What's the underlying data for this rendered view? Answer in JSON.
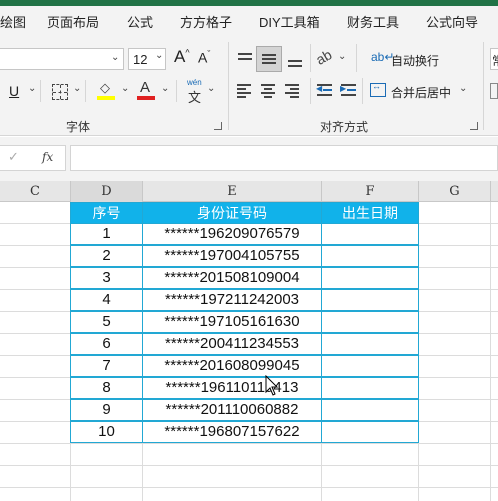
{
  "menu": {
    "tabs": [
      "绘图",
      "页面布局",
      "公式",
      "方方格子",
      "DIY工具箱",
      "财务工具",
      "公式向导"
    ]
  },
  "ribbon": {
    "font_size": "12",
    "font_group_label": "字体",
    "align_group_label": "对齐方式",
    "wrap_text_label": "自动换行",
    "merge_center_label": "合并后居中",
    "phonetic_top": "wén",
    "phonetic_bottom": "文",
    "font_grow": "A",
    "font_shrink": "A",
    "underline": "U",
    "right_edge_label": "常"
  },
  "formula_bar": {
    "fx_label": "fx",
    "content": ""
  },
  "columns": [
    "C",
    "D",
    "E",
    "F",
    "G"
  ],
  "table": {
    "headers": [
      "序号",
      "身份证号码",
      "出生日期"
    ],
    "rows": [
      [
        "1",
        "******196209076579",
        ""
      ],
      [
        "2",
        "******197004105755",
        ""
      ],
      [
        "3",
        "******201508109004",
        ""
      ],
      [
        "4",
        "******197211242003",
        ""
      ],
      [
        "5",
        "******197105161630",
        ""
      ],
      [
        "6",
        "******200411234553",
        ""
      ],
      [
        "7",
        "******201608099045",
        ""
      ],
      [
        "8",
        "******196110119413",
        ""
      ],
      [
        "9",
        "******201110060882",
        ""
      ],
      [
        "10",
        "******196807157622",
        ""
      ]
    ]
  },
  "colors": {
    "header_fill": "#11b2ea",
    "header_text": "#ffffff",
    "table_border": "#22a8d4",
    "highlight_color": "#ffff00",
    "font_color": "#e02020",
    "excel_green": "#217346"
  }
}
